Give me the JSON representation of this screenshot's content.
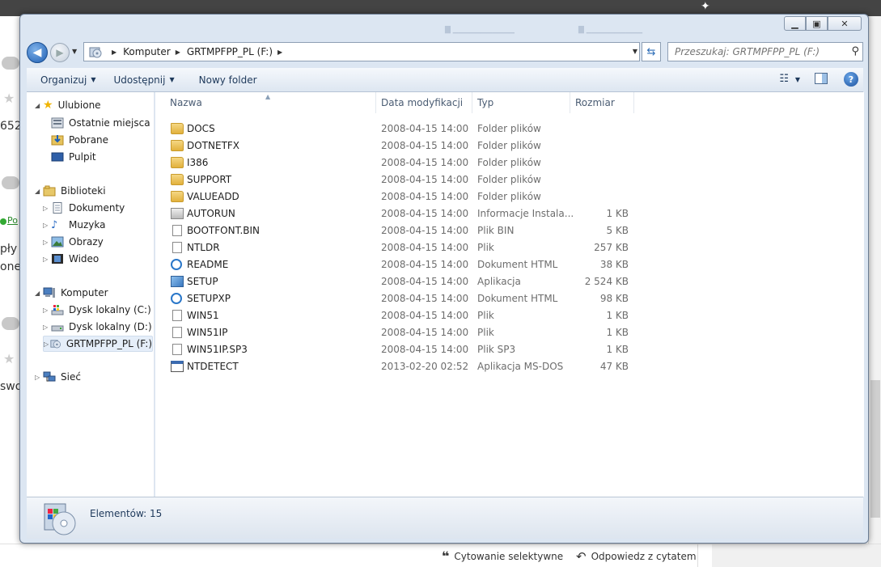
{
  "background": {
    "left_fragments": [
      "652",
      "Po",
      "pły",
      "one",
      "swo"
    ],
    "footer_actions": [
      {
        "label": "Cytowanie selektywne",
        "icon": "quote-icon"
      },
      {
        "label": "Odpowiedz z cytatem",
        "icon": "reply-icon"
      }
    ]
  },
  "window": {
    "caption_buttons": {
      "minimize": "minimize-icon",
      "restore": "restore-icon",
      "close": "close-icon"
    }
  },
  "address": {
    "crumbs": [
      "Komputer",
      "GRTMPFPP_PL (F:)"
    ]
  },
  "search": {
    "placeholder": "Przeszukaj: GRTMPFPP_PL (F:)"
  },
  "toolbar": {
    "organize": "Organizuj",
    "share": "Udostępnij",
    "new_folder": "Nowy folder"
  },
  "nav": {
    "favorites": "Ulubione",
    "recent": "Ostatnie miejsca",
    "downloads": "Pobrane",
    "desktop": "Pulpit",
    "libraries": "Biblioteki",
    "documents": "Dokumenty",
    "music": "Muzyka",
    "pictures": "Obrazy",
    "video": "Wideo",
    "computer": "Komputer",
    "drive_c": "Dysk lokalny (C:)",
    "drive_d": "Dysk lokalny (D:)",
    "drive_f": "GRTMPFPP_PL (F:)",
    "network": "Sieć"
  },
  "columns": {
    "name": "Nazwa",
    "modified": "Data modyfikacji",
    "type": "Typ",
    "size": "Rozmiar"
  },
  "files": [
    {
      "name": "DOCS",
      "date": "2008-04-15 14:00",
      "type": "Folder plików",
      "size": "",
      "icon": "folder-icon"
    },
    {
      "name": "DOTNETFX",
      "date": "2008-04-15 14:00",
      "type": "Folder plików",
      "size": "",
      "icon": "folder-icon"
    },
    {
      "name": "I386",
      "date": "2008-04-15 14:00",
      "type": "Folder plików",
      "size": "",
      "icon": "folder-icon"
    },
    {
      "name": "SUPPORT",
      "date": "2008-04-15 14:00",
      "type": "Folder plików",
      "size": "",
      "icon": "folder-icon"
    },
    {
      "name": "VALUEADD",
      "date": "2008-04-15 14:00",
      "type": "Folder plików",
      "size": "",
      "icon": "folder-icon"
    },
    {
      "name": "AUTORUN",
      "date": "2008-04-15 14:00",
      "type": "Informacje Instala...",
      "size": "1 KB",
      "icon": "setup-info-icon"
    },
    {
      "name": "BOOTFONT.BIN",
      "date": "2008-04-15 14:00",
      "type": "Plik BIN",
      "size": "5 KB",
      "icon": "file-icon"
    },
    {
      "name": "NTLDR",
      "date": "2008-04-15 14:00",
      "type": "Plik",
      "size": "257 KB",
      "icon": "file-icon"
    },
    {
      "name": "README",
      "date": "2008-04-15 14:00",
      "type": "Dokument HTML",
      "size": "38 KB",
      "icon": "html-document-icon"
    },
    {
      "name": "SETUP",
      "date": "2008-04-15 14:00",
      "type": "Aplikacja",
      "size": "2 524 KB",
      "icon": "application-icon"
    },
    {
      "name": "SETUPXP",
      "date": "2008-04-15 14:00",
      "type": "Dokument HTML",
      "size": "98 KB",
      "icon": "html-document-icon"
    },
    {
      "name": "WIN51",
      "date": "2008-04-15 14:00",
      "type": "Plik",
      "size": "1 KB",
      "icon": "file-icon"
    },
    {
      "name": "WIN51IP",
      "date": "2008-04-15 14:00",
      "type": "Plik",
      "size": "1 KB",
      "icon": "file-icon"
    },
    {
      "name": "WIN51IP.SP3",
      "date": "2008-04-15 14:00",
      "type": "Plik SP3",
      "size": "1 KB",
      "icon": "file-icon"
    },
    {
      "name": "NTDETECT",
      "date": "2013-02-20 02:52",
      "type": "Aplikacja MS-DOS",
      "size": "47 KB",
      "icon": "msdos-application-icon"
    }
  ],
  "status": {
    "count": "Elementów: 15"
  }
}
